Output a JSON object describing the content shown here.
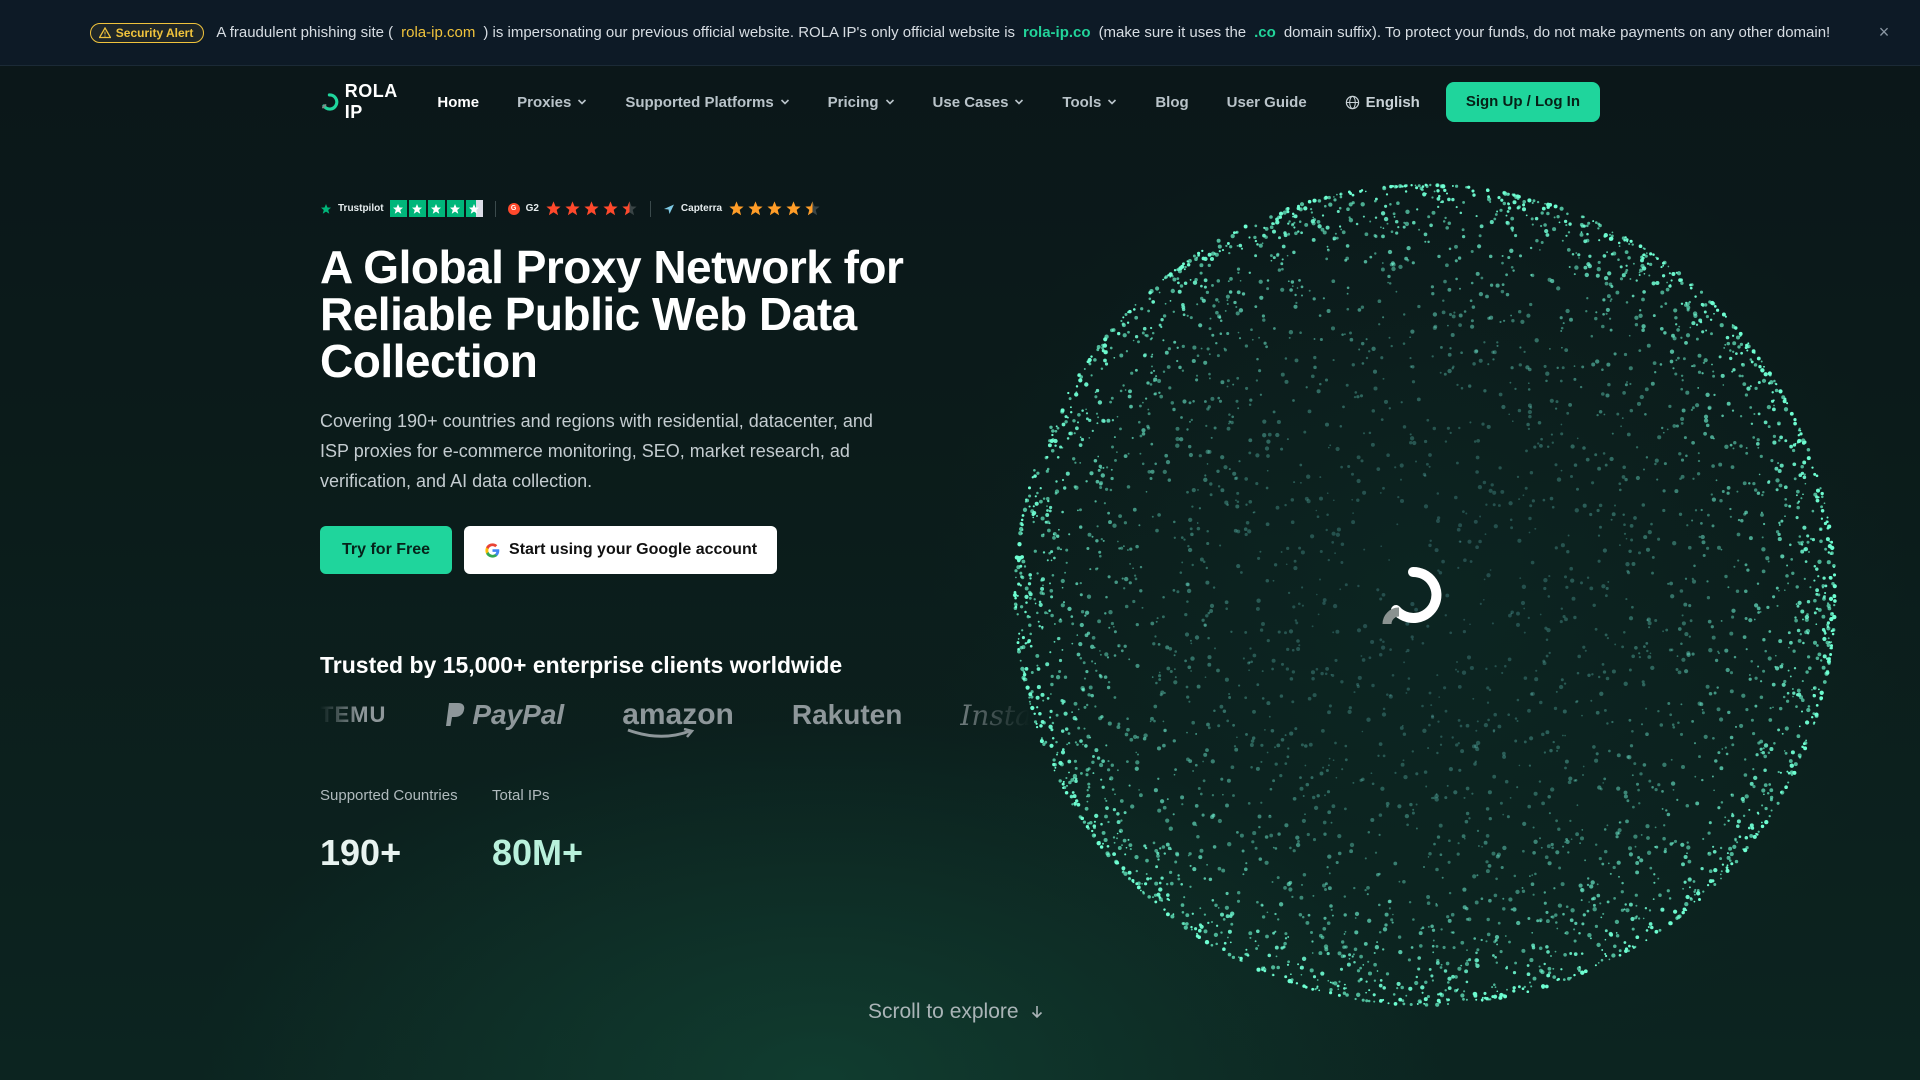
{
  "alert": {
    "badge": "Security Alert",
    "text1": "A fraudulent phishing site (",
    "phish_domain": "rola-ip.com",
    "text2": ") is impersonating our previous official website. ROLA IP's only official website is",
    "official_domain": "rola-ip.co",
    "text3": "(make sure it uses the",
    "suffix": ".co",
    "text4": "domain suffix). To protect your funds, do not make payments on any other domain!",
    "close_icon": "close-icon"
  },
  "nav": {
    "logo_text": "ROLA IP",
    "items": [
      {
        "label": "Home",
        "dropdown": false
      },
      {
        "label": "Proxies",
        "dropdown": true
      },
      {
        "label": "Supported Platforms",
        "dropdown": true
      },
      {
        "label": "Pricing",
        "dropdown": true
      },
      {
        "label": "Use Cases",
        "dropdown": true
      },
      {
        "label": "Tools",
        "dropdown": true
      },
      {
        "label": "Blog",
        "dropdown": false
      },
      {
        "label": "User Guide",
        "dropdown": false
      }
    ],
    "language": "English",
    "signup": "Sign Up / Log In"
  },
  "ratings": [
    {
      "name": "Trustpilot",
      "stars": 4.5
    },
    {
      "name": "G2",
      "stars": 4.5
    },
    {
      "name": "Capterra",
      "stars": 4.5
    }
  ],
  "hero": {
    "title": "A Global Proxy Network for Reliable Public Web Data Collection",
    "description": "Covering 190+ countries and regions with residential, datacenter, and ISP proxies for e-commerce monitoring, SEO, market research, ad verification, and AI data collection.",
    "try_button": "Try for Free",
    "google_button": "Start using your Google account"
  },
  "trusted": {
    "heading": "Trusted by 15,000+ enterprise clients worldwide",
    "brands": [
      "TEMU",
      "PayPal",
      "amazon",
      "Rakuten",
      "Instagram"
    ]
  },
  "stats": [
    {
      "label": "Supported Countries",
      "value": "190+"
    },
    {
      "label": "Total IPs",
      "value": "80M+"
    }
  ],
  "scroll_text": "Scroll to explore",
  "colors": {
    "accent": "#1fd59c",
    "background": "#0a1614",
    "alert_yellow": "#f0c33c"
  }
}
